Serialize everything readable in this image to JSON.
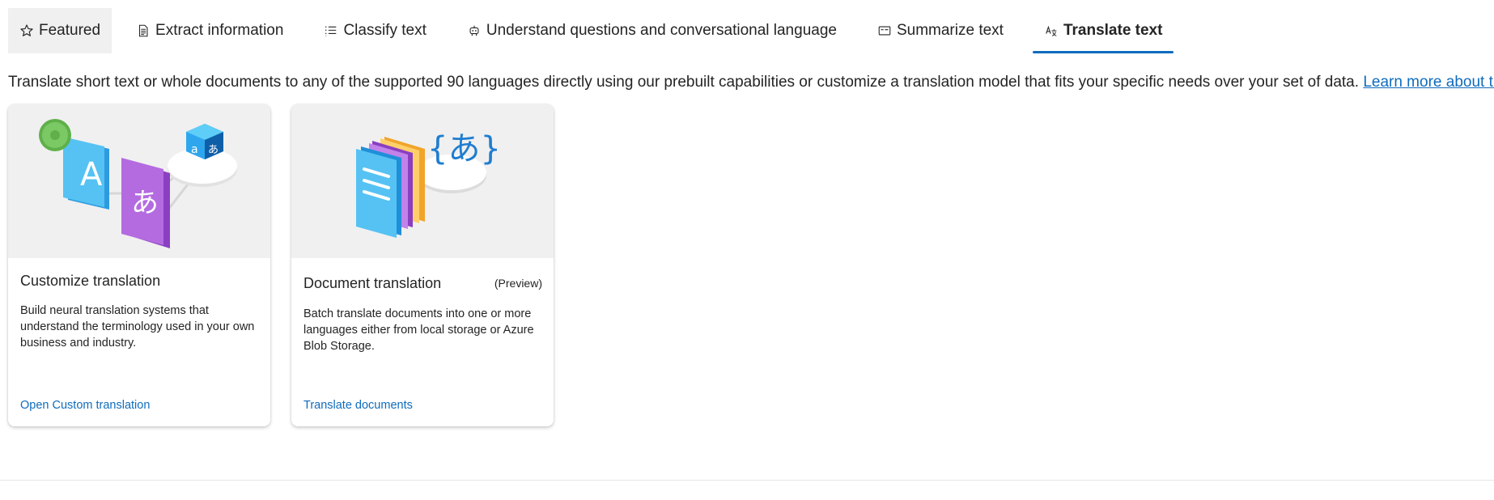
{
  "tabs": [
    {
      "label": "Featured",
      "icon": "star-icon"
    },
    {
      "label": "Extract information",
      "icon": "document-icon"
    },
    {
      "label": "Classify text",
      "icon": "list-icon"
    },
    {
      "label": "Understand questions and conversational language",
      "icon": "bot-icon"
    },
    {
      "label": "Summarize text",
      "icon": "summary-icon"
    },
    {
      "label": "Translate text",
      "icon": "translate-icon",
      "active": true
    }
  ],
  "description": {
    "text": "Translate short text or whole documents to any of the supported 90 languages directly using our prebuilt capabilities or customize a translation model that fits your specific needs over your set of data.",
    "link": "Learn more about translation."
  },
  "cards": [
    {
      "title": "Customize translation",
      "badge": "",
      "body": "Build neural translation systems that understand the terminology used in your own business and industry.",
      "action": "Open Custom translation",
      "illustration_text": {
        "a": "A",
        "ja": "あ",
        "cube_a": "a",
        "cube_ja": "あ"
      }
    },
    {
      "title": "Document translation",
      "badge": "(Preview)",
      "body": "Batch translate documents into one or more languages either from local storage or Azure Blob Storage.",
      "action": "Translate documents",
      "illustration_text": {
        "braces": "{あ}"
      }
    }
  ],
  "colors": {
    "accent": "#0f6cbd",
    "text": "#242424",
    "tab_selected_bg": "#f0f0f0"
  }
}
